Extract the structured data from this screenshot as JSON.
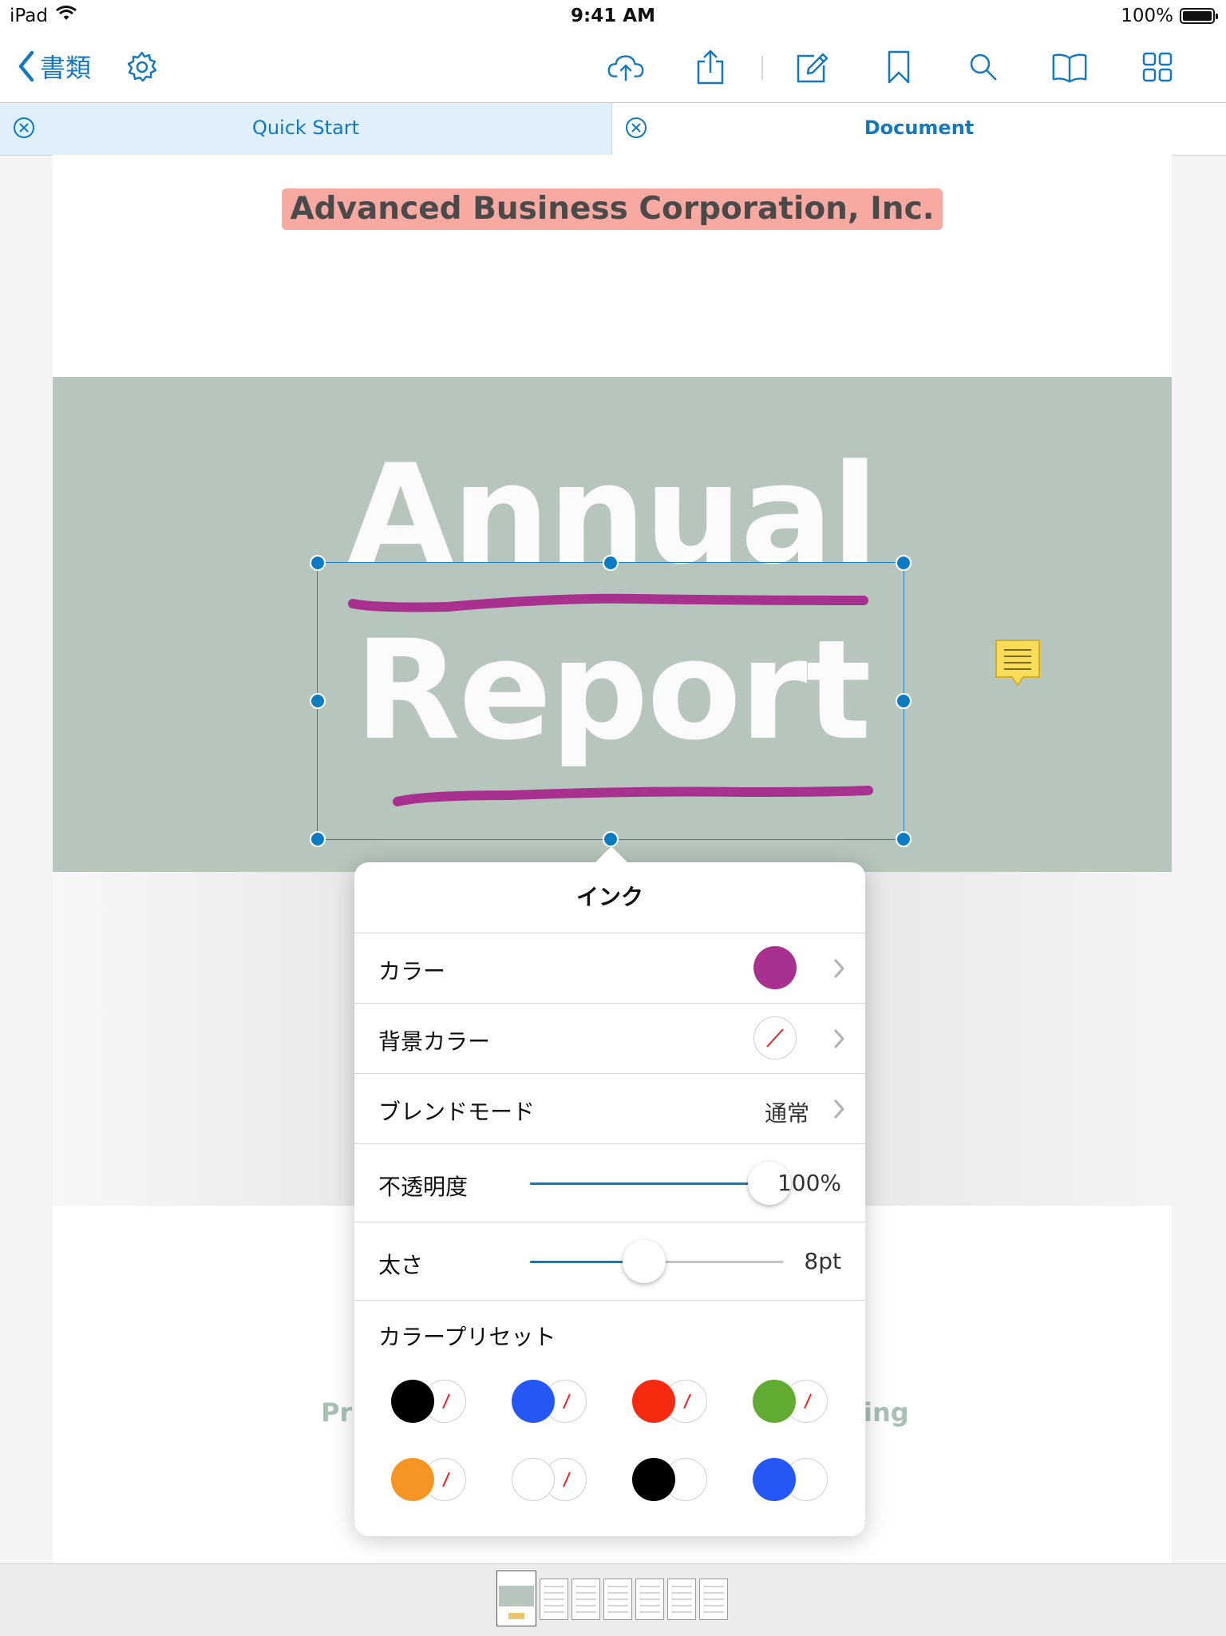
{
  "status_bar": {
    "device": "iPad",
    "time": "9:41 AM",
    "battery": "100%",
    "battery_level": 1.0
  },
  "nav": {
    "back_label": "書類",
    "icons": [
      "settings-gear-icon",
      "cloud-upload-icon",
      "share-icon",
      "edit-annotate-icon",
      "bookmark-icon",
      "search-icon",
      "reader-book-icon",
      "thumbnails-grid-icon"
    ]
  },
  "tabs": [
    {
      "label": "Quick Start",
      "active": true
    },
    {
      "label": "Document",
      "active": false
    }
  ],
  "document": {
    "company": "Advanced Business Corporation, Inc.",
    "title_line1": "Annual",
    "title_line2": "Report",
    "subtitle_left": "Pr",
    "subtitle_right": "ing",
    "highlight_color": "#f8aaa2",
    "banner_color": "#b7c6bc"
  },
  "ink_popover": {
    "title": "インク",
    "color_label": "カラー",
    "color_value": "#a8308f",
    "background_color_label": "背景カラー",
    "background_color_value": "none",
    "blend_mode_label": "ブレンドモード",
    "blend_mode_value": "通常",
    "opacity_label": "不透明度",
    "opacity_value": "100%",
    "opacity_fraction": 1.0,
    "thickness_label": "太さ",
    "thickness_value": "8pt",
    "thickness_fraction": 0.45,
    "presets_label": "カラープリセット",
    "presets": [
      {
        "color": "#000000",
        "background": "none"
      },
      {
        "color": "#2457f5",
        "background": "none"
      },
      {
        "color": "#f52a0e",
        "background": "none"
      },
      {
        "color": "#62ab33",
        "background": "none"
      },
      {
        "color": "#f59523",
        "background": "none"
      },
      {
        "color": "#ffffff",
        "background": "none"
      },
      {
        "color": "#000000",
        "background": "#ffffff"
      },
      {
        "color": "#2457f5",
        "background": "#ffffff"
      }
    ]
  },
  "page_thumbnails": {
    "count": 7,
    "current": 1
  }
}
